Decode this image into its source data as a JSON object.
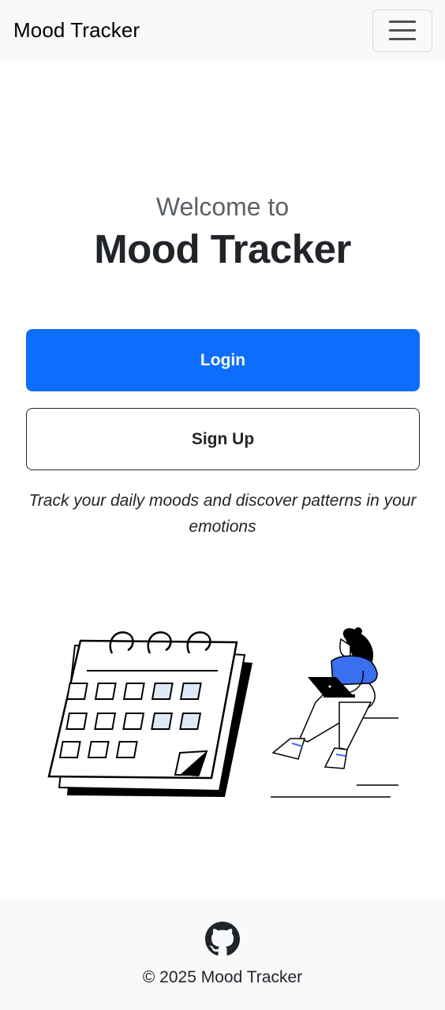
{
  "navbar": {
    "brand": "Mood Tracker",
    "menu_icon": "hamburger-menu-icon"
  },
  "hero": {
    "welcome": "Welcome to",
    "title": "Mood Tracker"
  },
  "actions": {
    "login_label": "Login",
    "signup_label": "Sign Up"
  },
  "tagline": "Track your daily moods and discover patterns in your emotions",
  "illustration": {
    "name": "calendar-and-person-with-laptop",
    "accent_color": "#3a6ff0",
    "cell_highlight_color": "#dde8f8"
  },
  "footer": {
    "icon": "github-icon",
    "copyright": "© 2025 Mood Tracker"
  },
  "colors": {
    "primary": "#0d6efd",
    "navbar_bg": "#f8f9fa",
    "text": "#212529"
  }
}
